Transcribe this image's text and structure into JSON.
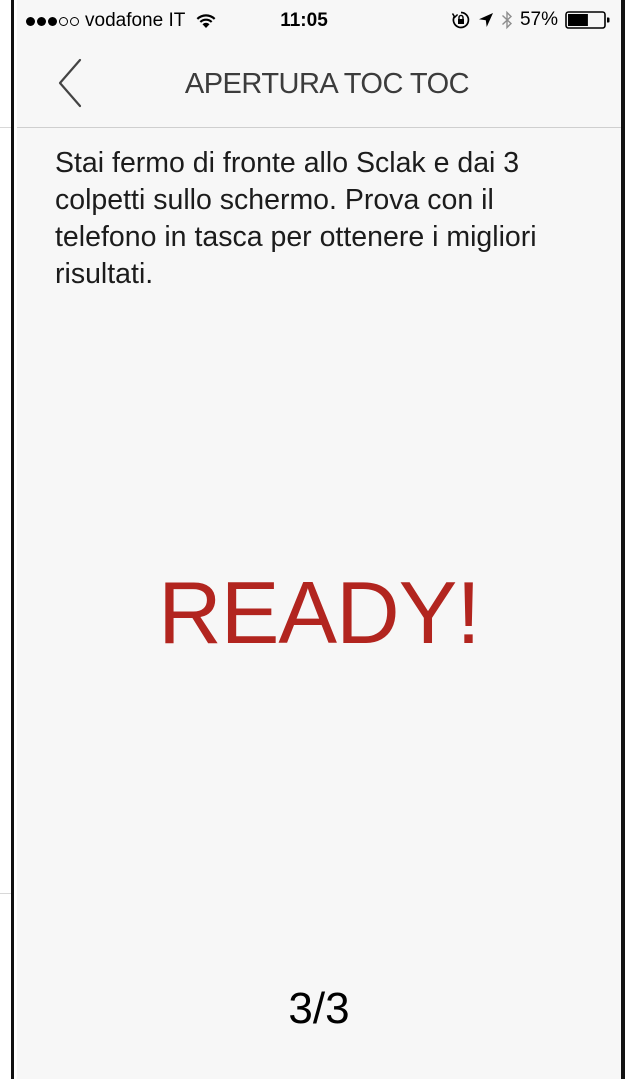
{
  "status_bar": {
    "carrier": "vodafone IT",
    "time": "11:05",
    "battery_percent": "57%",
    "signal_bars_filled": 3,
    "signal_bars_total": 5,
    "battery_level": 0.57,
    "icons": [
      "wifi-icon",
      "orientation-lock-icon",
      "location-icon",
      "bluetooth-icon",
      "battery-icon"
    ]
  },
  "nav": {
    "back_icon": "chevron-left-icon",
    "title": "APERTURA TOC TOC"
  },
  "main": {
    "instructions": "Stai fermo di fronte allo Sclak e dai 3 colpetti sullo schermo. Prova con il telefono in tasca per ottenere i migliori risultati.",
    "status": "READY!",
    "counter": "3/3"
  },
  "colors": {
    "accent": "#b2251f",
    "background": "#f7f7f7"
  }
}
